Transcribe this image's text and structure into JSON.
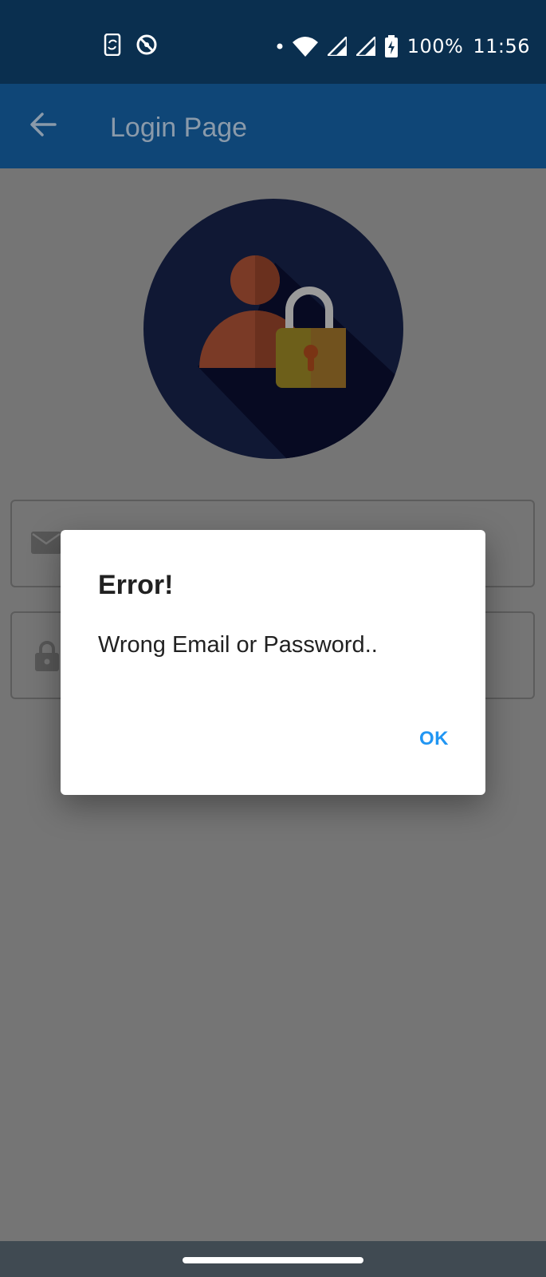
{
  "status_bar": {
    "battery": "100%",
    "time": "11:56",
    "icons": [
      "phone-sync-icon",
      "no-disturb-icon",
      "dot-icon",
      "wifi-icon",
      "signal-icon",
      "signal-icon",
      "battery-charging-icon"
    ]
  },
  "app_bar": {
    "title": "Login Page",
    "back_icon": "arrow-back-icon"
  },
  "form": {
    "email_icon": "email-icon",
    "password_icon": "lock-icon"
  },
  "dialog": {
    "title": "Error!",
    "message": "Wrong Email or Password..",
    "ok_label": "OK"
  },
  "colors": {
    "status_bar": "#0a2f4f",
    "app_bar": "#0f4677",
    "scrim_background": "#757575",
    "accent": "#2196f3",
    "nav_bar": "#404a52"
  }
}
